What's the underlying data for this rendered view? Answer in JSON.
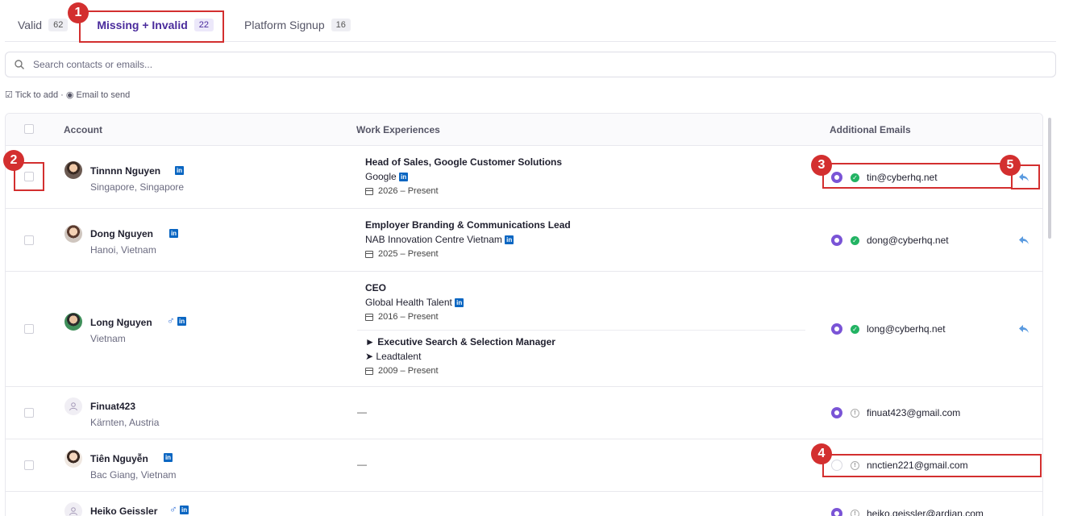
{
  "tabs": [
    {
      "label": "Valid",
      "count": "62"
    },
    {
      "label": "Missing + Invalid",
      "count": "22"
    },
    {
      "label": "Platform Signup",
      "count": "16"
    }
  ],
  "search": {
    "placeholder": "Search contacts or emails..."
  },
  "legend": "☑ Tick to add · ◉ Email to send",
  "table": {
    "headers": {
      "account": "Account",
      "work": "Work Experiences",
      "emails": "Additional Emails"
    }
  },
  "rows": [
    {
      "name": "Tinnnn Nguyen",
      "location": "Singapore, Singapore",
      "experiences": [
        {
          "title": "Head of Sales, Google Customer Solutions",
          "company": "Google",
          "dates": "2026 – Present"
        }
      ],
      "email": "tin@cyberhq.net"
    },
    {
      "name": "Dong Nguyen",
      "location": "Hanoi, Vietnam",
      "experiences": [
        {
          "title": "Employer Branding & Communications Lead",
          "company": "NAB Innovation Centre Vietnam",
          "dates": "2025 – Present"
        }
      ],
      "email": "dong@cyberhq.net"
    },
    {
      "name": "Long Nguyen",
      "location": "Vietnam",
      "experiences": [
        {
          "title": "CEO",
          "company": "Global Health Talent",
          "dates": "2016 – Present"
        },
        {
          "title": "► Executive Search & Selection Manager",
          "company": "➤ Leadtalent",
          "dates": "2009 – Present"
        }
      ],
      "email": "long@cyberhq.net"
    },
    {
      "name": "Finuat423",
      "location": "Kärnten, Austria",
      "empty_exp": "—",
      "email": "finuat423@gmail.com"
    },
    {
      "name": "Tiên Nguyễn",
      "location": "Bac Giang, Vietnam",
      "empty_exp": "—",
      "email": "nnctien221@gmail.com"
    },
    {
      "name": "Heiko Geissler",
      "location": "",
      "email": "heiko.geissler@ardian.com"
    }
  ],
  "annotations": [
    "1",
    "2",
    "3",
    "4",
    "5"
  ],
  "colors": {
    "accent": "#7a54d6",
    "annotation": "#d32f2f",
    "valid": "#22b363",
    "linkedin": "#0a66c2"
  }
}
